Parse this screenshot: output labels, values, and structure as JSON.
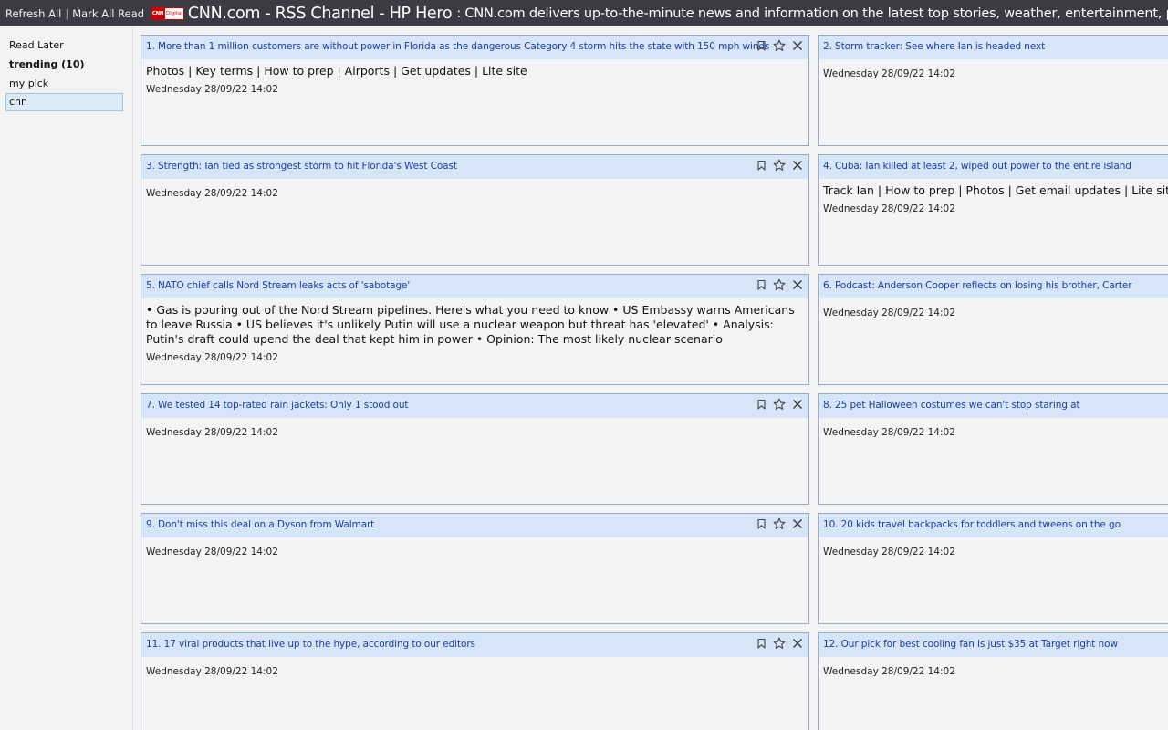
{
  "toolbar": {
    "refresh_all": "Refresh All",
    "separator": "|",
    "mark_all_read": "Mark All Read"
  },
  "feed": {
    "logo_text": "CNN",
    "logo_subtext": "Digital",
    "title": "CNN.com - RSS Channel - HP Hero",
    "description": ": CNN.com delivers up-to-the-minute news and information on the latest top stories, weather, entertainment, politics and more."
  },
  "sidebar": {
    "items": [
      {
        "label": "Read Later"
      },
      {
        "label": "trending (10)"
      },
      {
        "label": "my pick"
      },
      {
        "label": "cnn"
      }
    ]
  },
  "colors": {
    "topbar": "#3b3b45",
    "card_header": "#d6e5f8",
    "title_link": "#1a3fa8",
    "card_border": "#97aac8"
  },
  "icons": {
    "read_later": "bookmark-icon",
    "favorite": "star-icon",
    "close": "close-icon"
  },
  "articles": [
    {
      "title": "1. More than 1 million customers are without power in Florida as the dangerous Category 4 storm hits the state with 150 mph winds",
      "description": "Photos | Key terms | How to prep | Airports | Get updates | Lite site",
      "date": "Wednesday 28/09/22 14:02"
    },
    {
      "title": "2. Storm tracker: See where Ian is headed next",
      "description": "",
      "date": "Wednesday 28/09/22 14:02"
    },
    {
      "title": "3. Strength: Ian tied as strongest storm to hit Florida's West Coast",
      "description": "",
      "date": "Wednesday 28/09/22 14:02"
    },
    {
      "title": "4. Cuba: Ian killed at least 2, wiped out power to the entire island",
      "description": "Track Ian | How to prep | Photos | Get email updates | Lite site",
      "date": "Wednesday 28/09/22 14:02"
    },
    {
      "title": "5. NATO chief calls Nord Stream leaks acts of 'sabotage'",
      "description": "• Gas is pouring out of the Nord Stream pipelines. Here's what you need to know • US Embassy warns Americans to leave Russia • US believes it's unlikely Putin will use a nuclear weapon but threat has 'elevated' • Analysis: Putin's draft could upend the deal that kept him in power • Opinion: The most likely nuclear scenario",
      "date": "Wednesday 28/09/22 14:02"
    },
    {
      "title": "6. Podcast: Anderson Cooper reflects on losing his brother, Carter",
      "description": "",
      "date": "Wednesday 28/09/22 14:02"
    },
    {
      "title": "7. We tested 14 top-rated rain jackets: Only 1 stood out",
      "description": "",
      "date": "Wednesday 28/09/22 14:02"
    },
    {
      "title": "8. 25 pet Halloween costumes we can't stop staring at",
      "description": "",
      "date": "Wednesday 28/09/22 14:02"
    },
    {
      "title": "9. Don't miss this deal on a Dyson from Walmart",
      "description": "",
      "date": "Wednesday 28/09/22 14:02"
    },
    {
      "title": "10. 20 kids travel backpacks for toddlers and tweens on the go",
      "description": "",
      "date": "Wednesday 28/09/22 14:02"
    },
    {
      "title": "11. 17 viral products that live up to the hype, according to our editors",
      "description": "",
      "date": "Wednesday 28/09/22 14:02"
    },
    {
      "title": "12. Our pick for best cooling fan is just $35 at Target right now",
      "description": "",
      "date": "Wednesday 28/09/22 14:02"
    }
  ]
}
